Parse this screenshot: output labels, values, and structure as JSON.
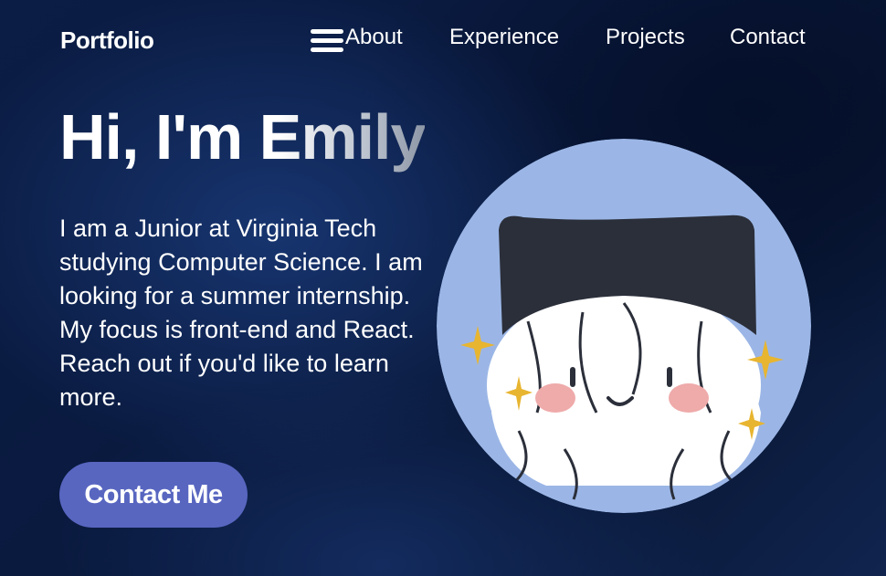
{
  "nav": {
    "logo": "Portfolio",
    "links": [
      "About",
      "Experience",
      "Projects",
      "Contact"
    ]
  },
  "hero": {
    "title": "Hi, I'm Emily",
    "description": "I am a Junior at Virginia Tech studying Computer Science. I am looking for a summer internship. My focus is front-end and React. Reach out if you'd like to learn more.",
    "cta_label": "Contact Me"
  },
  "icons": {
    "menu": "hamburger-menu-icon",
    "sparkle": "sparkle-icon"
  },
  "colors": {
    "background": "#0b1d45",
    "button": "#5866c0",
    "avatar_bg": "#9bb6e6",
    "hat": "#2b2f3a",
    "blush": "#efaaaa",
    "sparkle": "#e8b530"
  }
}
